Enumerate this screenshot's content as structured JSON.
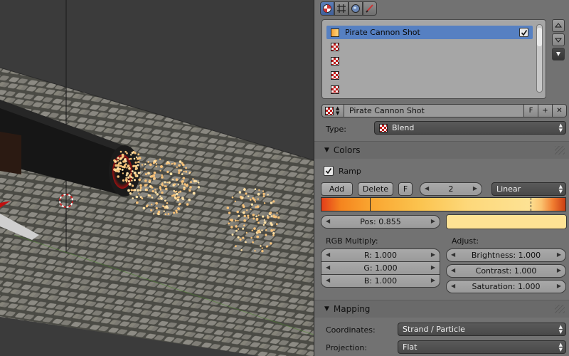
{
  "texture_slots": [
    {
      "label": "Pirate Cannon Shot",
      "active": true,
      "enabled": true
    },
    {
      "label": ""
    },
    {
      "label": ""
    },
    {
      "label": ""
    },
    {
      "label": ""
    }
  ],
  "texture": {
    "name": "Pirate Cannon Shot",
    "fake_user": "F",
    "add": "+",
    "remove": "✕"
  },
  "type": {
    "label": "Type:",
    "value": "Blend"
  },
  "colors": {
    "header": "Colors",
    "ramp_label": "Ramp",
    "add": "Add",
    "delete": "Delete",
    "flip": "F",
    "active_index": "2",
    "interpolation": "Linear",
    "pos": "Pos: 0.855",
    "stop_color": "#fde294",
    "rgb_multiply_label": "RGB Multiply:",
    "r": "R: 1.000",
    "g": "G: 1.000",
    "b": "B: 1.000",
    "adjust_label": "Adjust:",
    "brightness": "Brightness: 1.000",
    "contrast": "Contrast: 1.000",
    "saturation": "Saturation: 1.000"
  },
  "mapping": {
    "header": "Mapping",
    "coordinates_label": "Coordinates:",
    "coordinates_value": "Strand / Particle",
    "projection_label": "Projection:",
    "projection_value": "Flat"
  },
  "icons": {
    "header": [
      "texture-tab-icon",
      "texture-coords-icon",
      "world-icon",
      "brush-icon"
    ],
    "slot": "checker-texture-icon",
    "type": "checker-texture-icon"
  },
  "colors_accent": {
    "active_slot": "#5680c2",
    "dropdown": "#4e4e4e",
    "panel": "#727272"
  }
}
